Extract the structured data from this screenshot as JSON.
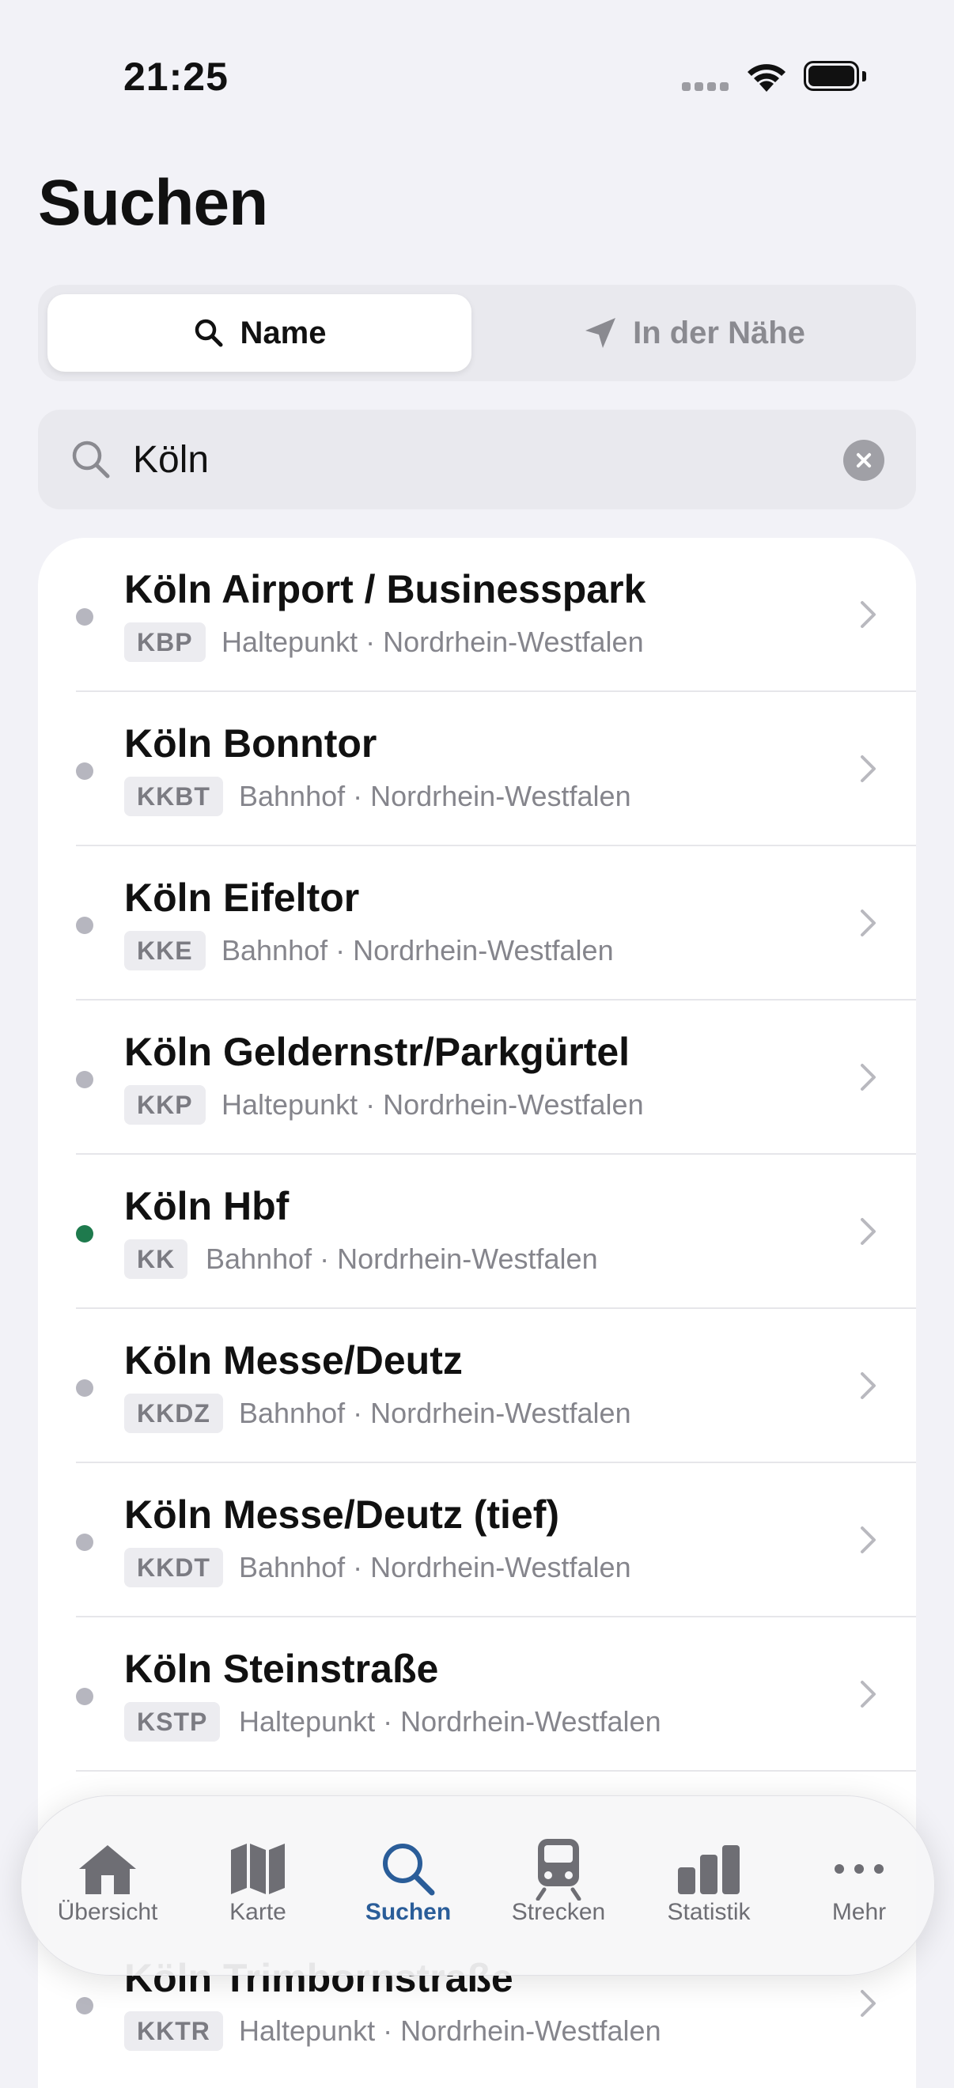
{
  "status_bar": {
    "time": "21:25"
  },
  "page": {
    "title": "Suchen"
  },
  "segments": {
    "name": "Name",
    "nearby": "In der Nähe"
  },
  "search": {
    "value": "Köln"
  },
  "results": [
    {
      "name": "Köln Airport / Businesspark",
      "code": "KBP",
      "type": "Haltepunkt · Nordrhein-Westfalen",
      "status": "gray"
    },
    {
      "name": "Köln Bonntor",
      "code": "KKBT",
      "type": "Bahnhof · Nordrhein-Westfalen",
      "status": "gray"
    },
    {
      "name": "Köln Eifeltor",
      "code": "KKE",
      "type": "Bahnhof · Nordrhein-Westfalen",
      "status": "gray"
    },
    {
      "name": "Köln Geldernstr/Parkgürtel",
      "code": "KKP",
      "type": "Haltepunkt · Nordrhein-Westfalen",
      "status": "gray"
    },
    {
      "name": "Köln Hbf",
      "code": "KK",
      "type": "Bahnhof · Nordrhein-Westfalen",
      "status": "green"
    },
    {
      "name": "Köln Messe/Deutz",
      "code": "KKDZ",
      "type": "Bahnhof · Nordrhein-Westfalen",
      "status": "gray"
    },
    {
      "name": "Köln Messe/Deutz (tief)",
      "code": "KKDT",
      "type": "Bahnhof · Nordrhein-Westfalen",
      "status": "gray"
    },
    {
      "name": "Köln Steinstraße",
      "code": "KSTP",
      "type": "Haltepunkt · Nordrhein-Westfalen",
      "status": "gray"
    },
    {
      "name": "Köln Trimbornstraße",
      "code": "KKTR",
      "type": "Haltepunkt · Nordrhein-Westfalen",
      "status": "gray"
    }
  ],
  "colors": {
    "accent": "#2a5d99",
    "status_green": "#1e7a4d",
    "status_gray": "#b6b6bf"
  },
  "tabs": [
    {
      "label": "Übersicht",
      "icon": "house-icon"
    },
    {
      "label": "Karte",
      "icon": "map-icon"
    },
    {
      "label": "Suchen",
      "icon": "search-icon",
      "active": true
    },
    {
      "label": "Strecken",
      "icon": "train-icon"
    },
    {
      "label": "Statistik",
      "icon": "bar-chart-icon"
    },
    {
      "label": "Mehr",
      "icon": "ellipsis-icon"
    }
  ]
}
